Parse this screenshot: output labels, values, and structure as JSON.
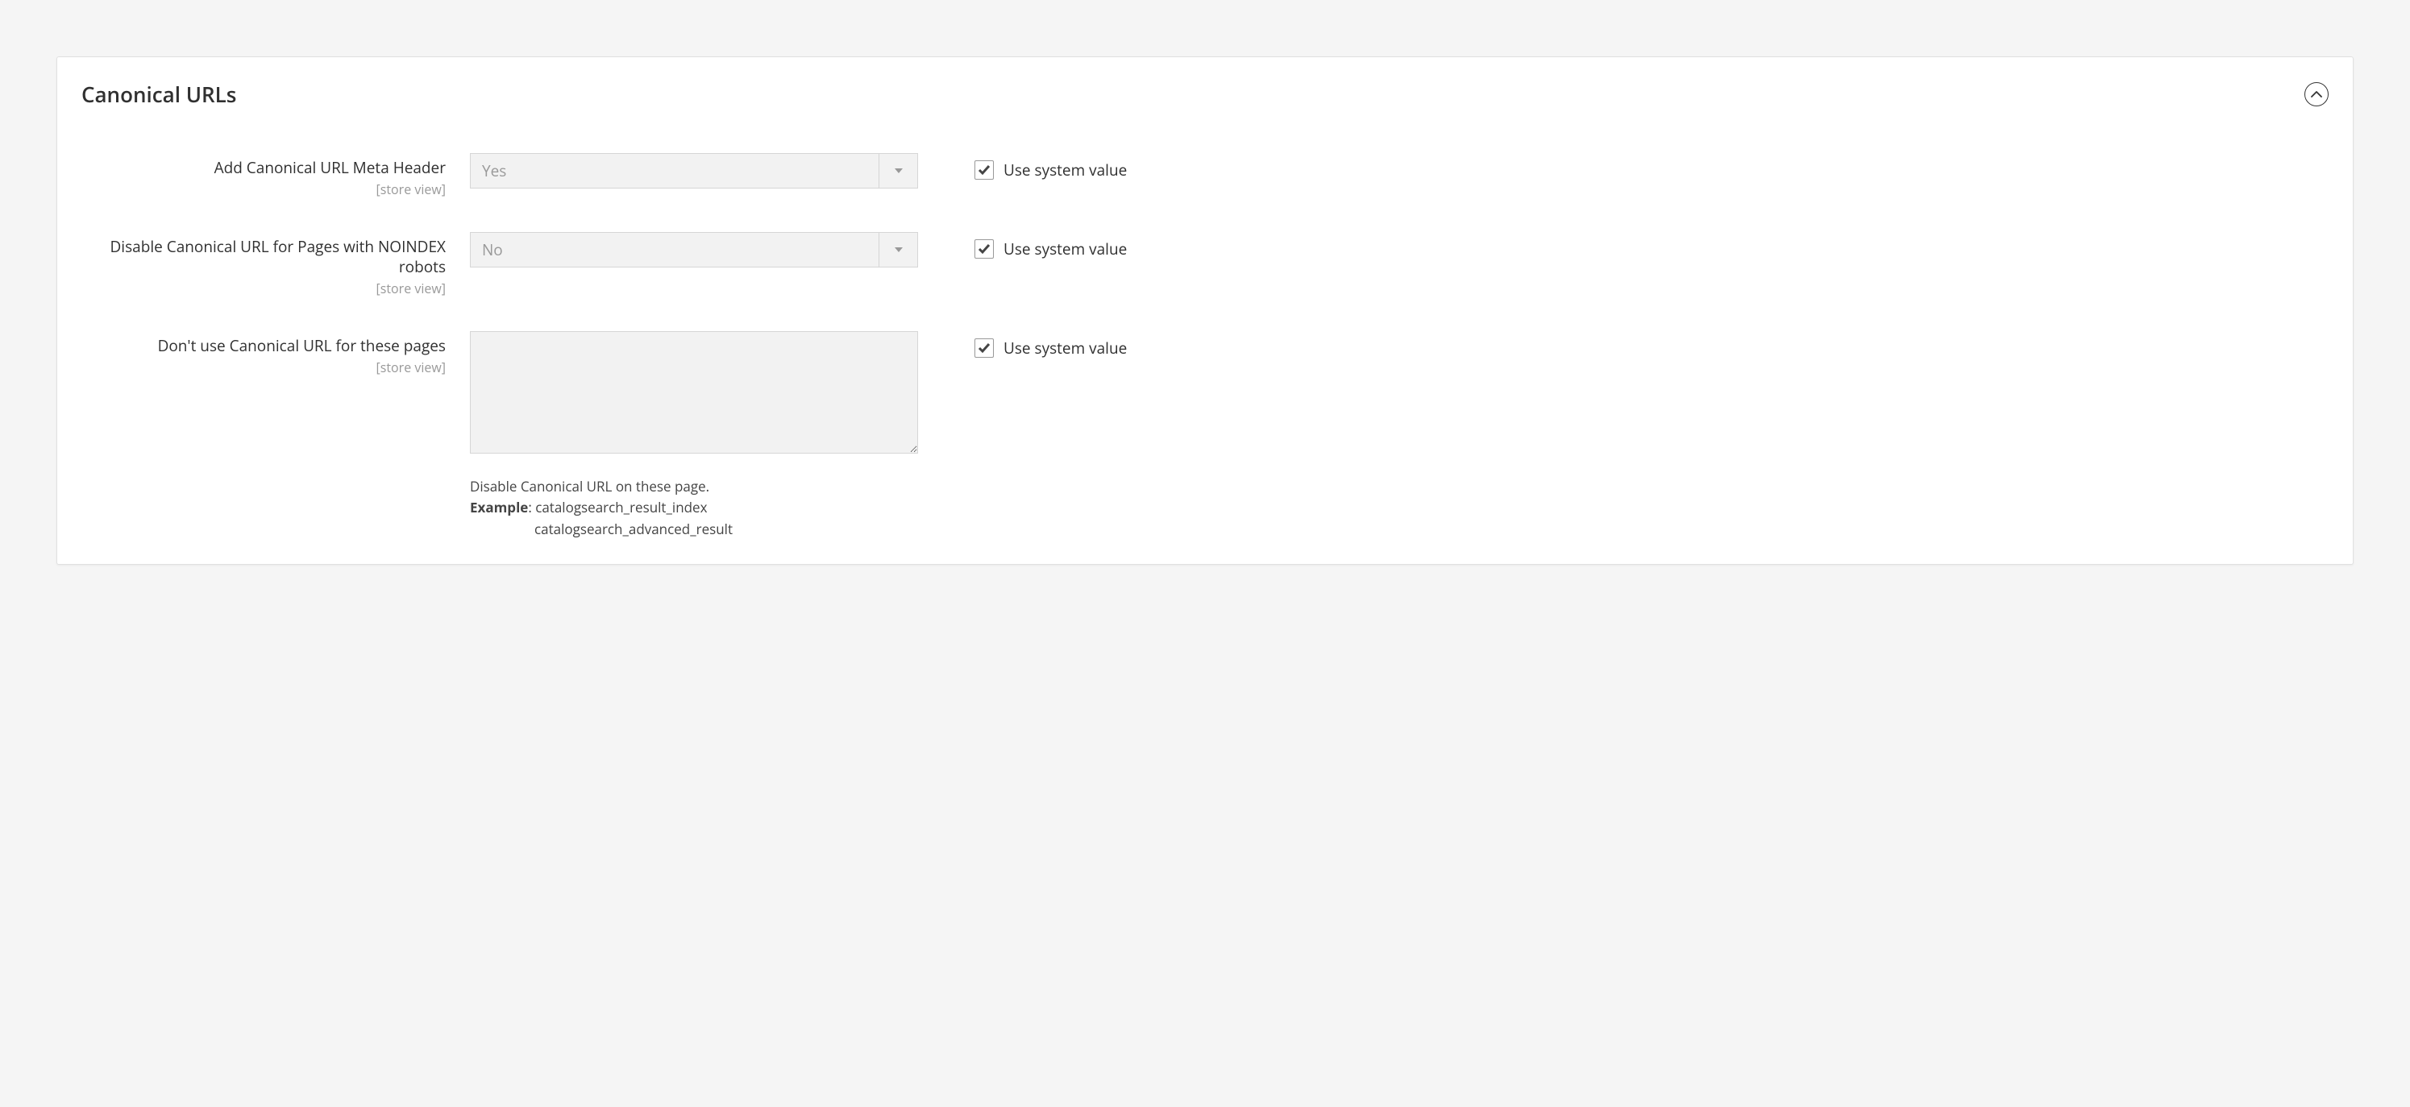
{
  "panel": {
    "title": "Canonical URLs"
  },
  "scope_label": "[store view]",
  "use_system_label": "Use system value",
  "fields": {
    "add_canonical": {
      "label": "Add Canonical URL Meta Header",
      "value": "Yes",
      "use_system": true
    },
    "disable_noindex": {
      "label": "Disable Canonical URL for Pages with NOINDEX robots",
      "value": "No",
      "use_system": true
    },
    "exclude_pages": {
      "label": "Don't use Canonical URL for these pages",
      "value": "",
      "use_system": true,
      "help_line1": "Disable Canonical URL on these page.",
      "example_label": "Example",
      "example_val1": "catalogsearch_result_index",
      "example_val2": "catalogsearch_advanced_result"
    }
  }
}
